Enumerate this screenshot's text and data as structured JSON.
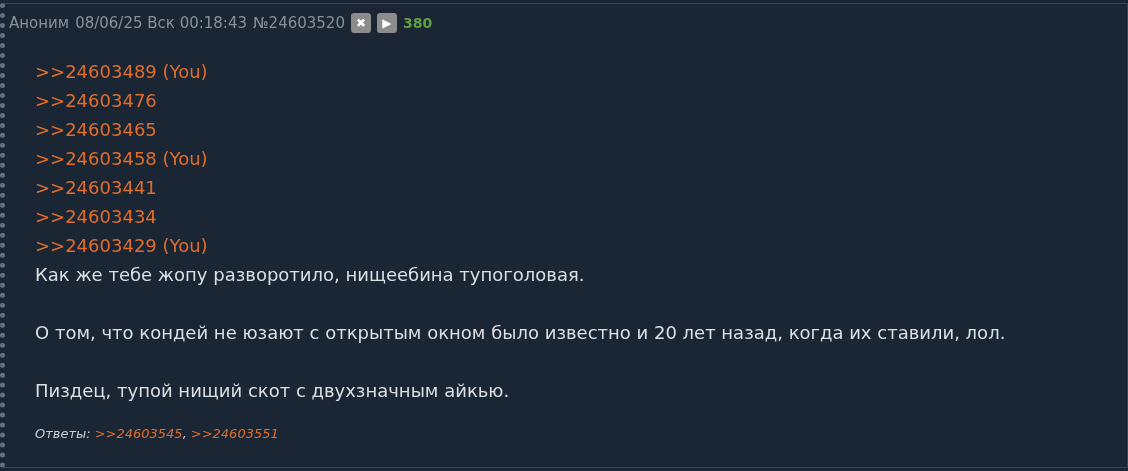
{
  "post": {
    "name": "Аноним",
    "date": "08/06/25 Вск 00:18:43",
    "number": "№24603520",
    "hide_button": "✖",
    "play_button": "▶",
    "counter": "380",
    "reply_links": [
      ">>24603489 (You)",
      ">>24603476",
      ">>24603465",
      ">>24603458 (You)",
      ">>24603441",
      ">>24603434",
      ">>24603429 (You)"
    ],
    "paragraphs": [
      "Как же тебе жопу разворотило, нищеебина тупоголовая.",
      "О том, что кондей не юзают с открытым окном было известно и 20 лет назад, когда их ставили, лол.",
      "Пиздец, тупой нищий скот с двухзначным айкью."
    ],
    "replies_label": "Ответы:",
    "replies_separator": ",",
    "replies": [
      ">>24603545",
      ">>24603551"
    ]
  }
}
